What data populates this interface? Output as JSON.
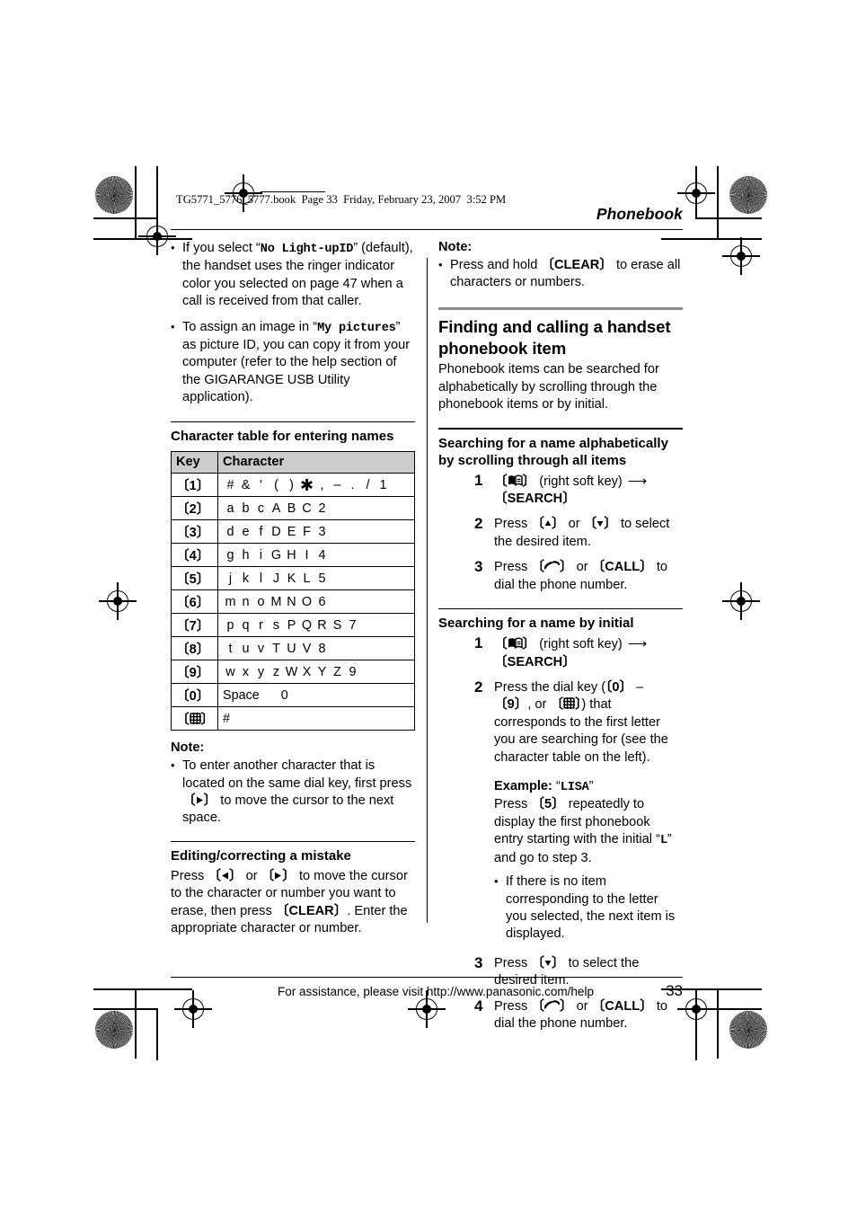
{
  "printer_header": "TG5771_5776_5777.book  Page 33  Friday, February 23, 2007  3:52 PM",
  "running_head": "Phonebook",
  "footer": {
    "assistance_text": "For assistance, please visit http://www.panasonic.com/help",
    "page_number": "33"
  },
  "colors": {
    "table_header_bg": "#cccccc",
    "section_rule": "#8c8c8c",
    "text": "#000000"
  },
  "left_column": {
    "intro_bullets": [
      {
        "part1": "If you select “",
        "mono1": "No Light-upID",
        "part2": "” (default), the handset uses the ringer indicator color you selected on page 47 when a call is received from that caller."
      },
      {
        "part1": "To assign an image in “",
        "mono1": "My pictures",
        "part2": "” as picture ID, you can copy it from your computer (refer to the help section of the GIGARANGE USB Utility application)."
      }
    ],
    "char_table": {
      "title": "Character table for entering names",
      "headers": [
        "Key",
        "Character"
      ],
      "rows": [
        {
          "key": "[1]",
          "key_glyph": "digit",
          "chars": [
            "#",
            "&",
            "'",
            "(",
            ")",
            "*",
            ",",
            "–",
            ".",
            "/",
            "1"
          ]
        },
        {
          "key": "[2]",
          "key_glyph": "digit",
          "chars": [
            "a",
            "b",
            "c",
            "A",
            "B",
            "C",
            "2"
          ]
        },
        {
          "key": "[3]",
          "key_glyph": "digit",
          "chars": [
            "d",
            "e",
            "f",
            "D",
            "E",
            "F",
            "3"
          ]
        },
        {
          "key": "[4]",
          "key_glyph": "digit",
          "chars": [
            "g",
            "h",
            "i",
            "G",
            "H",
            "I",
            "4"
          ]
        },
        {
          "key": "[5]",
          "key_glyph": "digit",
          "chars": [
            "j",
            "k",
            "l",
            "J",
            "K",
            "L",
            "5"
          ]
        },
        {
          "key": "[6]",
          "key_glyph": "digit",
          "chars": [
            "m",
            "n",
            "o",
            "M",
            "N",
            "O",
            "6"
          ]
        },
        {
          "key": "[7]",
          "key_glyph": "digit",
          "chars": [
            "p",
            "q",
            "r",
            "s",
            "P",
            "Q",
            "R",
            "S",
            "7"
          ]
        },
        {
          "key": "[8]",
          "key_glyph": "digit",
          "chars": [
            "t",
            "u",
            "v",
            "T",
            "U",
            "V",
            "8"
          ]
        },
        {
          "key": "[9]",
          "key_glyph": "digit",
          "chars": [
            "w",
            "x",
            "y",
            "z",
            "W",
            "X",
            "Y",
            "Z",
            "9"
          ]
        },
        {
          "key": "[0]",
          "key_glyph": "digit",
          "chars_text": "Space      0"
        },
        {
          "key": "[#]",
          "key_glyph": "hash-key-icon",
          "chars_text": "#"
        }
      ]
    },
    "note": {
      "label": "Note:",
      "bullet_part1": "To enter another character that is located on the same dial key, first press ",
      "bullet_key": "[►]",
      "bullet_part2": " to move the cursor to the next space."
    },
    "editing": {
      "title": "Editing/correcting a mistake",
      "part1": "Press ",
      "key1": "[◄]",
      "part2": " or ",
      "key2": "[►]",
      "part3": " to move the cursor to the character or number you want to erase, then press ",
      "key3": "[CLEAR]",
      "part4": ". Enter the appropriate character or number."
    }
  },
  "right_column": {
    "note": {
      "label": "Note:",
      "bullet_part1": "Press and hold ",
      "bullet_key": "[CLEAR]",
      "bullet_part2": " to erase all characters or numbers."
    },
    "section": {
      "heading": "Finding and calling a handset phonebook item",
      "intro": "Phonebook items can be searched for alphabetically by scrolling through the phonebook items or by initial."
    },
    "sub_alpha": {
      "title": "Searching for a name alphabetically by scrolling through all items",
      "steps": [
        {
          "num": "1",
          "key_icon": "phonebook-soft-key-icon",
          "text_after_icon": " (right soft key) ",
          "arrow": "⟶",
          "key2": "[SEARCH]"
        },
        {
          "num": "2",
          "part1": "Press ",
          "key1": "[▲]",
          "part2": " or ",
          "key2": "[▼]",
          "part3": " to select the desired item."
        },
        {
          "num": "3",
          "part1": "Press ",
          "key_icon": "phone-handset-icon",
          "part2": " or ",
          "key2": "[CALL]",
          "part3": " to dial the phone number."
        }
      ]
    },
    "sub_initial": {
      "title": "Searching for a name by initial",
      "steps": [
        {
          "num": "1",
          "key_icon": "phonebook-soft-key-icon",
          "text_after_icon": " (right soft key) ",
          "arrow": "⟶",
          "key2": "[SEARCH]"
        },
        {
          "num": "2",
          "part1": "Press the dial key (",
          "key1": "[0]",
          "part2": " – ",
          "key2": "[9]",
          "part3": ", or ",
          "key3_icon": "hash-key-icon",
          "part4": ") that corresponds to the first letter you are searching for (see the character table on the left)."
        },
        {
          "num": "3",
          "part1": "Press ",
          "key1": "[▼]",
          "part2": " to select the desired item."
        },
        {
          "num": "4",
          "part1": "Press ",
          "key_icon": "phone-handset-icon",
          "part2": " or ",
          "key2": "[CALL]",
          "part3": " to dial the phone number."
        }
      ],
      "example": {
        "label": "Example:",
        "quoted_mono": "LISA",
        "line_part1": "Press ",
        "line_key": "[5]",
        "line_part2": " repeatedly to display the first phonebook entry starting with the initial “",
        "line_mono": "L",
        "line_part3": "” and go to step 3.",
        "bullet": "If there is no item corresponding to the letter you selected, the next item is displayed."
      }
    }
  }
}
